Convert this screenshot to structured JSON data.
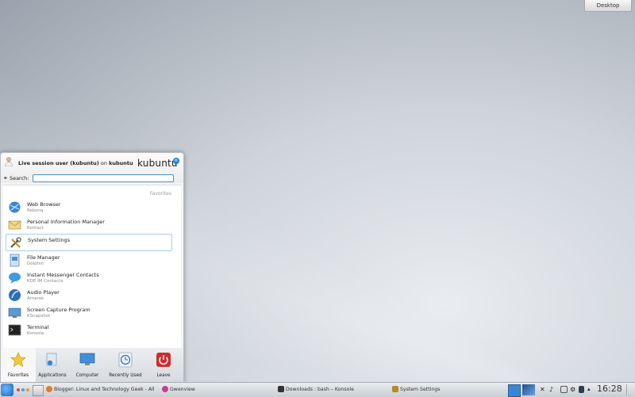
{
  "desktop": {
    "button_label": "Desktop"
  },
  "launcher": {
    "user_name": "Live session user (kubuntu)",
    "user_on": "on",
    "host": "kubuntu",
    "logo_text": "kubuntu",
    "search_label": "Search:",
    "search_value": "",
    "favorites_heading": "Favorites",
    "items": [
      {
        "title": "Web Browser",
        "subtitle": "Rekonq",
        "icon": "web-browser-icon",
        "selected": false
      },
      {
        "title": "Personal Information Manager",
        "subtitle": "Kontact",
        "icon": "pim-icon",
        "selected": false
      },
      {
        "title": "System Settings",
        "subtitle": "",
        "icon": "system-settings-icon",
        "selected": true
      },
      {
        "title": "File Manager",
        "subtitle": "Dolphin",
        "icon": "file-manager-icon",
        "selected": false
      },
      {
        "title": "Instant Messenger Contacts",
        "subtitle": "KDE IM Contacts",
        "icon": "im-contacts-icon",
        "selected": false
      },
      {
        "title": "Audio Player",
        "subtitle": "Amarok",
        "icon": "audio-player-icon",
        "selected": false
      },
      {
        "title": "Screen Capture Program",
        "subtitle": "KSnapshot",
        "icon": "screen-capture-icon",
        "selected": false
      },
      {
        "title": "Terminal",
        "subtitle": "Konsole",
        "icon": "terminal-icon",
        "selected": false
      }
    ],
    "tabs": [
      {
        "label": "Favorites",
        "icon": "star-icon",
        "active": true
      },
      {
        "label": "Applications",
        "icon": "applications-icon",
        "active": false
      },
      {
        "label": "Computer",
        "icon": "computer-icon",
        "active": false
      },
      {
        "label": "Recently Used",
        "icon": "clock-icon",
        "active": false
      },
      {
        "label": "Leave",
        "icon": "power-icon",
        "active": false
      }
    ]
  },
  "taskbar": {
    "tasks": [
      {
        "label": "Blogger: Linux and Technology Geek - All",
        "icon": "firefox-icon"
      },
      {
        "label": "Gwenview",
        "icon": "gwenview-icon"
      },
      {
        "label": "Downloads : bash – Konsole",
        "icon": "konsole-icon"
      },
      {
        "label": "System Settings",
        "icon": "system-settings-icon"
      }
    ],
    "clock": "16:28"
  },
  "colors": {
    "accent": "#1e7fd3",
    "selection_border": "#a9cde8",
    "leave_red": "#d22b2b"
  }
}
